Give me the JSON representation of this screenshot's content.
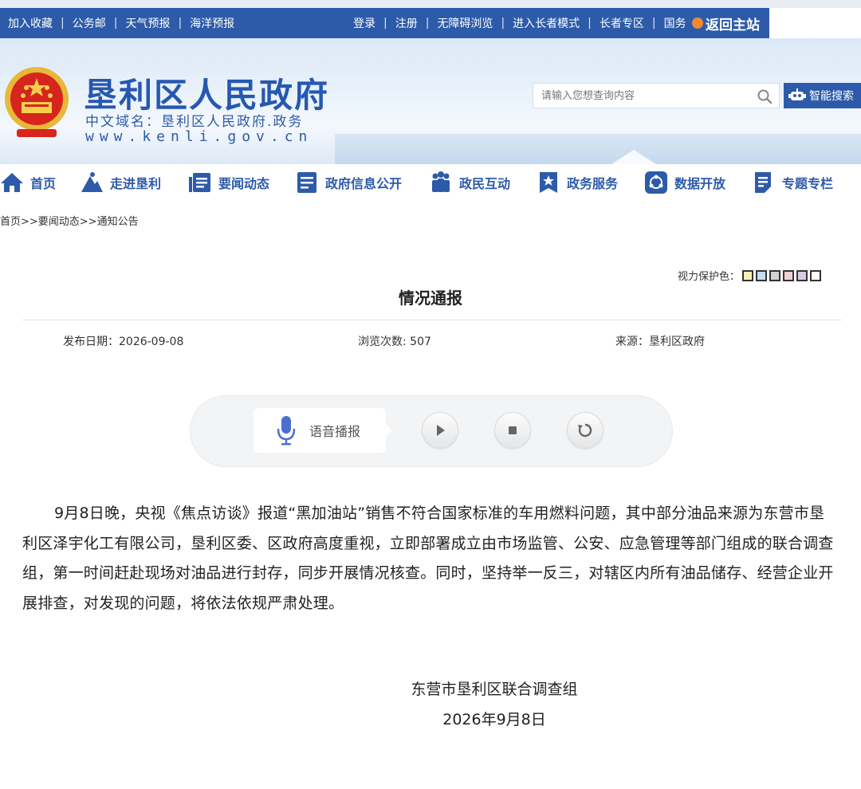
{
  "topbar": {
    "left_links": [
      "加入收藏",
      "公务邮",
      "天气预报",
      "海洋预报"
    ],
    "right_links": [
      "登录",
      "注册",
      "无障碍浏览",
      "进入长者模式",
      "长者专区",
      "国务"
    ],
    "back_home": "返回主站"
  },
  "header": {
    "site_title": "垦利区人民政府",
    "domain_cn": "中文域名：垦利区人民政府.政务",
    "domain_en": "www.kenli.gov.cn",
    "search_placeholder": "请输入您想查询内容",
    "smart_search_label": "智能搜索"
  },
  "nav": {
    "items": [
      "首页",
      "走进垦利",
      "要闻动态",
      "政府信息公开",
      "政民互动",
      "政务服务",
      "数据开放",
      "专题专栏"
    ]
  },
  "breadcrumb": "首页>>要闻动态>>通知公告",
  "eye_protect": {
    "label": "视力保护色：",
    "colors": [
      "#f6f0b4",
      "#c9dcef",
      "#d3d3d3",
      "#f0cfd9",
      "#d9cbe8",
      "#ffffff"
    ]
  },
  "article": {
    "title": "情况通报",
    "publish_date": "发布日期：2026-09-08",
    "views": "浏览次数: 507",
    "source": "来源：垦利区政府",
    "body": "9月8日晚，央视《焦点访谈》报道“黑加油站”销售不符合国家标准的车用燃料问题，其中部分油品来源为东营市垦利区泽宇化工有限公司，垦利区委、区政府高度重视，立即部署成立由市场监管、公安、应急管理等部门组成的联合调查组，第一时间赶赴现场对油品进行封存，同步开展情况核查。同时，坚持举一反三，对辖区内所有油品储存、经营企业开展排查，对发现的问题，将依法依规严肃处理。",
    "signature": "东营市垦利区联合调查组",
    "sign_date": "2026年9月8日"
  },
  "player": {
    "voice_label": "语音播报"
  },
  "colors": {
    "brand_blue": "#2d5ba9",
    "title_blue": "#2558b0"
  }
}
